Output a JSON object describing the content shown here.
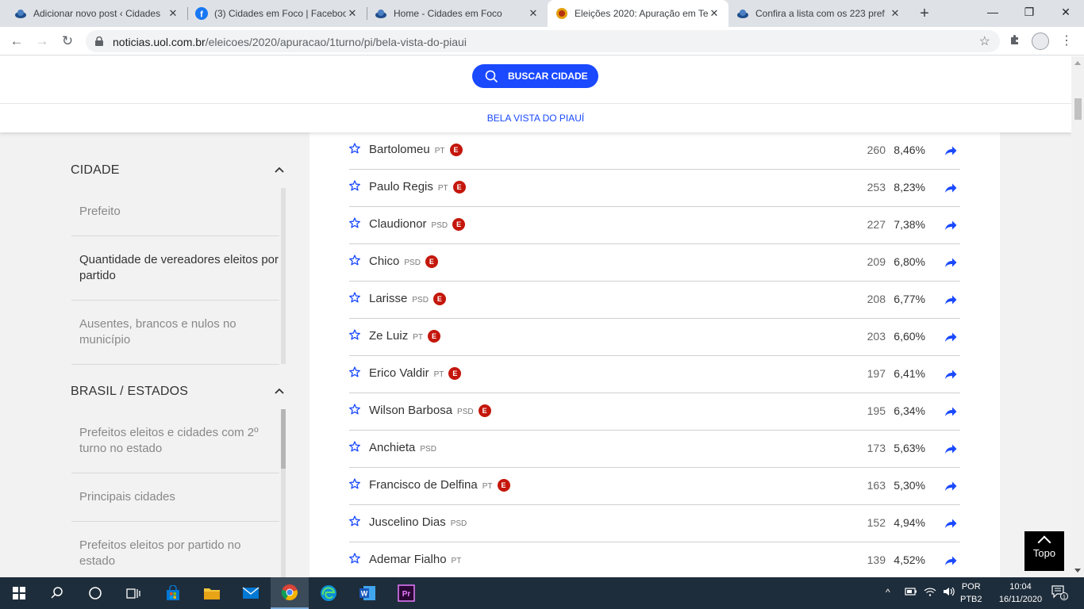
{
  "browser": {
    "tabs": [
      {
        "title": "Adicionar novo post ‹ Cidades",
        "favicon": "site-logo-icon"
      },
      {
        "title": "(3) Cidades em Foco | Faceboo",
        "favicon": "facebook-icon"
      },
      {
        "title": "Home - Cidades em Foco",
        "favicon": "site-logo-icon"
      },
      {
        "title": "Eleições 2020: Apuração em Te",
        "favicon": "uol-icon",
        "active": true
      },
      {
        "title": "Confira a lista com os 223 pref",
        "favicon": "site-logo-icon"
      }
    ],
    "url_host": "noticias.uol.com.br",
    "url_path": "/eleicoes/2020/apuracao/1turno/pi/bela-vista-do-piaui"
  },
  "header": {
    "search_label": "BUSCAR CIDADE",
    "city_name": "BELA VISTA DO PIAUÍ"
  },
  "sidebar": {
    "sections": [
      {
        "title": "CIDADE",
        "items": [
          {
            "label": "Prefeito"
          },
          {
            "label": "Quantidade de vereadores eleitos por partido"
          },
          {
            "label": "Ausentes, brancos e nulos no município"
          }
        ]
      },
      {
        "title": "BRASIL / ESTADOS",
        "items": [
          {
            "label": "Prefeitos eleitos e cidades com 2º turno no estado"
          },
          {
            "label": "Principais cidades"
          },
          {
            "label": "Prefeitos eleitos por partido no estado"
          }
        ]
      }
    ]
  },
  "candidates": [
    {
      "name": "Bartolomeu",
      "party": "PT",
      "elected": "E",
      "votes": "260",
      "pct": "8,46%"
    },
    {
      "name": "Paulo Regis",
      "party": "PT",
      "elected": "E",
      "votes": "253",
      "pct": "8,23%"
    },
    {
      "name": "Claudionor",
      "party": "PSD",
      "elected": "E",
      "votes": "227",
      "pct": "7,38%"
    },
    {
      "name": "Chico",
      "party": "PSD",
      "elected": "E",
      "votes": "209",
      "pct": "6,80%"
    },
    {
      "name": "Larisse",
      "party": "PSD",
      "elected": "E",
      "votes": "208",
      "pct": "6,77%"
    },
    {
      "name": "Ze Luiz",
      "party": "PT",
      "elected": "E",
      "votes": "203",
      "pct": "6,60%"
    },
    {
      "name": "Erico Valdir",
      "party": "PT",
      "elected": "E",
      "votes": "197",
      "pct": "6,41%"
    },
    {
      "name": "Wilson Barbosa",
      "party": "PSD",
      "elected": "E",
      "votes": "195",
      "pct": "6,34%"
    },
    {
      "name": "Anchieta",
      "party": "PSD",
      "elected": "",
      "votes": "173",
      "pct": "5,63%"
    },
    {
      "name": "Francisco de Delfina",
      "party": "PT",
      "elected": "E",
      "votes": "163",
      "pct": "5,30%"
    },
    {
      "name": "Juscelino Dias",
      "party": "PSD",
      "elected": "",
      "votes": "152",
      "pct": "4,94%"
    },
    {
      "name": "Ademar Fialho",
      "party": "PT",
      "elected": "",
      "votes": "139",
      "pct": "4,52%"
    }
  ],
  "topo_label": "Topo",
  "taskbar": {
    "lang_line1": "POR",
    "lang_line2": "PTB2",
    "time": "10:04",
    "date": "16/11/2020",
    "notifications": "1"
  },
  "colors": {
    "accent": "#1a49ff",
    "elected_badge": "#c4170c",
    "taskbar": "#1e2d3b"
  }
}
